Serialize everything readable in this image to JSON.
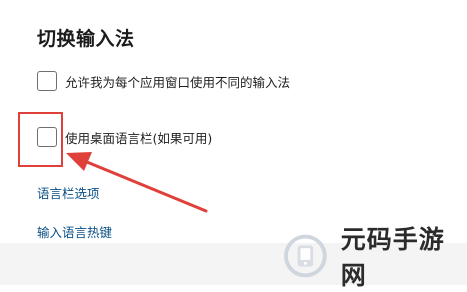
{
  "settings": {
    "title": "切换输入法",
    "options": [
      {
        "label": "允许我为每个应用窗口使用不同的输入法",
        "checked": false
      },
      {
        "label": "使用桌面语言栏(如果可用)",
        "checked": false
      }
    ],
    "links": [
      {
        "label": "语言栏选项"
      },
      {
        "label": "输入语言热键"
      }
    ]
  },
  "annotation": {
    "color": "#e0403a"
  },
  "watermark": {
    "text": "元码手游网",
    "icon": "brand-logo-icon"
  }
}
